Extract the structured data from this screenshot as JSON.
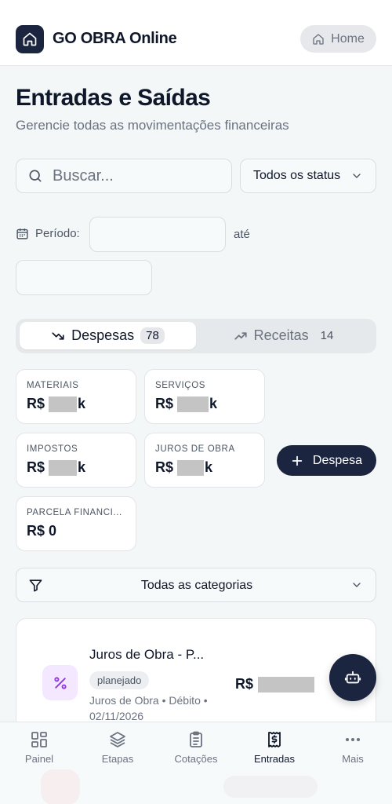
{
  "app": {
    "title": "GO OBRA Online",
    "home_label": "Home"
  },
  "page": {
    "title": "Entradas e Saídas",
    "subtitle": "Gerencie todas as movimentações financeiras"
  },
  "search": {
    "placeholder": "Buscar...",
    "value": ""
  },
  "status_filter": {
    "selected": "Todos os status"
  },
  "period": {
    "label": "Período:",
    "to_label": "até",
    "start": "",
    "end": ""
  },
  "tabs": [
    {
      "label": "Despesas",
      "count": "78",
      "active": true
    },
    {
      "label": "Receitas",
      "count": "14",
      "active": false
    }
  ],
  "summary_cards": [
    {
      "label": "MATERIAIS",
      "prefix": "R$",
      "suffix": "k"
    },
    {
      "label": "SERVIÇOS",
      "prefix": "R$",
      "suffix": "k"
    },
    {
      "label": "IMPOSTOS",
      "prefix": "R$",
      "suffix": "k"
    },
    {
      "label": "JUROS DE OBRA",
      "prefix": "R$",
      "suffix": "k"
    },
    {
      "label": "PARCELA FINANCI...",
      "prefix": "R$",
      "value": "0"
    }
  ],
  "add_expense_label": "Despesa",
  "category_filter": {
    "selected": "Todas as categorias"
  },
  "transactions": [
    {
      "title": "Juros de Obra - P...",
      "status": "planejado",
      "meta": "Juros de Obra • Débito • 02/11/2026",
      "amount_prefix": "R$"
    }
  ],
  "bottom_nav": [
    {
      "label": "Painel",
      "icon": "grid-icon"
    },
    {
      "label": "Etapas",
      "icon": "layers-icon"
    },
    {
      "label": "Cotações",
      "icon": "clipboard-icon"
    },
    {
      "label": "Entradas",
      "icon": "receipt-dollar-icon",
      "active": true
    },
    {
      "label": "Mais",
      "icon": "more-dots-icon"
    }
  ],
  "colors": {
    "primary": "#1b2540",
    "background": "#f3f7f7",
    "accent_purple": "#9333ea"
  }
}
